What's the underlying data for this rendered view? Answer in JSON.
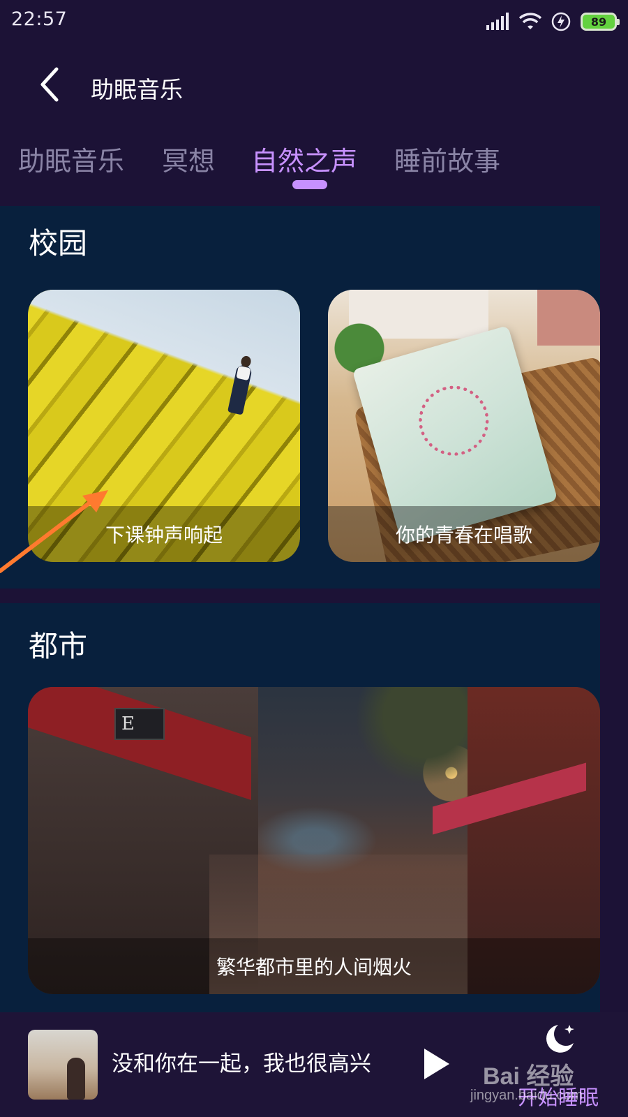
{
  "status_bar": {
    "time": "22:57",
    "battery": "89",
    "icons": [
      "signal-icon",
      "wifi-icon",
      "charging-icon",
      "battery-icon"
    ]
  },
  "header": {
    "title": "助眠音乐",
    "back_icon": "chevron-left-icon"
  },
  "tabs": [
    {
      "label": "助眠音乐",
      "active": false
    },
    {
      "label": "冥想",
      "active": false
    },
    {
      "label": "自然之声",
      "active": true
    },
    {
      "label": "睡前故事",
      "active": false
    }
  ],
  "sections": [
    {
      "title": "校园",
      "cards": [
        {
          "caption": "下课钟声响起"
        },
        {
          "caption": "你的青春在唱歌"
        }
      ]
    },
    {
      "title": "都市",
      "cards": [
        {
          "caption": "繁华都市里的人间烟火"
        }
      ]
    }
  ],
  "city_card": {
    "sign_text": "E"
  },
  "player": {
    "track_title": "没和你在一起，我也很高兴",
    "play_icon": "play-icon",
    "sleep_label": "开始睡眠",
    "sleep_icon": "moon-stars-icon"
  },
  "watermark": {
    "brand": "Bai 经验",
    "domain": "jingyan.baidu.com"
  },
  "colors": {
    "background": "#1c1236",
    "content_panel": "#08203d",
    "accent": "#c791ff",
    "tab_inactive": "#8a84a6",
    "annotation_arrow": "#ff7a2f"
  }
}
